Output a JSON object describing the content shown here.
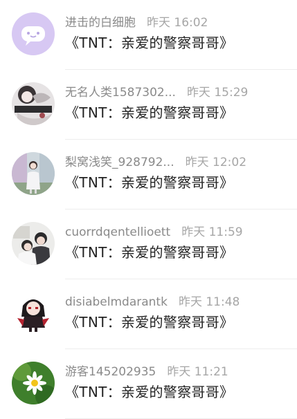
{
  "comments": [
    {
      "name": "进击的白细胞",
      "time": "昨天 16:02",
      "title": "《TNT：亲爱的警察哥哥》",
      "avatar_icon": "ghost-mascot-avatar"
    },
    {
      "name": "无名人类1587302...",
      "time": "昨天 15:29",
      "title": "《TNT：亲爱的警察哥哥》",
      "avatar_icon": "anime-character-avatar"
    },
    {
      "name": "梨窝浅笑_928792...",
      "time": "昨天 12:02",
      "title": "《TNT：亲爱的警察哥哥》",
      "avatar_icon": "girl-photo-avatar"
    },
    {
      "name": "cuorrdqentellioett",
      "time": "昨天 11:59",
      "title": "《TNT：亲爱的警察哥哥》",
      "avatar_icon": "couple-photo-avatar"
    },
    {
      "name": "disiabelmdarantk",
      "time": "昨天 11:48",
      "title": "《TNT：亲爱的警察哥哥》",
      "avatar_icon": "chibi-character-avatar"
    },
    {
      "name": "游客145202935",
      "time": "昨天 11:21",
      "title": "《TNT：亲爱的警察哥哥》",
      "avatar_icon": "daisy-flower-avatar"
    }
  ]
}
